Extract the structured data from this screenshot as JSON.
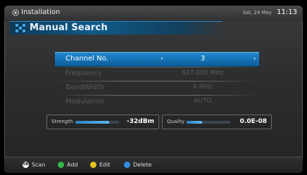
{
  "app": {
    "title": "Installation"
  },
  "clock": {
    "date": "Sat, 24 May",
    "time": "11:13"
  },
  "page": {
    "title": "Manual Search"
  },
  "menu": {
    "items": [
      {
        "label": "Channel No.",
        "value": "3"
      },
      {
        "label": "Frequency",
        "value": "647.000 MHz"
      },
      {
        "label": "BandWidth",
        "value": "6 MHz"
      },
      {
        "label": "Modulation",
        "value": "AUTO"
      }
    ],
    "left_arrow": "‹",
    "right_arrow": "›"
  },
  "signal": {
    "strength": {
      "label": "Strength",
      "value": "-32dBm",
      "level": 0.78
    },
    "quality": {
      "label": "Quality",
      "value": "0.0E-08",
      "level": 0.36
    }
  },
  "footer": {
    "keys": [
      {
        "label": "Scan",
        "glyph": "OK",
        "color": "#ffffff"
      },
      {
        "label": "Add",
        "color": "#33b84a"
      },
      {
        "label": "Edit",
        "color": "#e6c21c"
      },
      {
        "label": "Delete",
        "color": "#2f8fe0"
      }
    ]
  }
}
